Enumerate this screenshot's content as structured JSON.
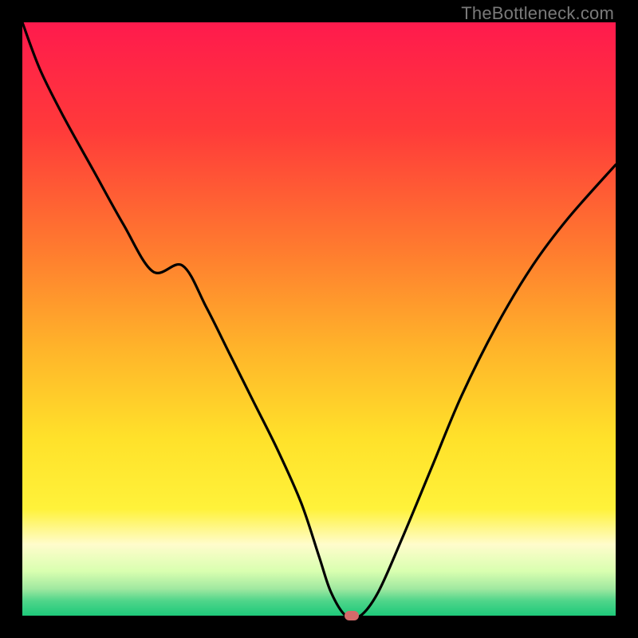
{
  "watermark": "TheBottleneck.com",
  "chart_data": {
    "type": "line",
    "title": "",
    "xlabel": "",
    "ylabel": "",
    "xlim": [
      0,
      100
    ],
    "ylim": [
      0,
      100
    ],
    "gradient_stops": [
      {
        "pos": 0.0,
        "color": "#ff1a4d"
      },
      {
        "pos": 0.18,
        "color": "#ff3a3a"
      },
      {
        "pos": 0.38,
        "color": "#ff7a2f"
      },
      {
        "pos": 0.55,
        "color": "#ffb42a"
      },
      {
        "pos": 0.7,
        "color": "#ffe12a"
      },
      {
        "pos": 0.82,
        "color": "#fff23a"
      },
      {
        "pos": 0.88,
        "color": "#fffccc"
      },
      {
        "pos": 0.925,
        "color": "#d9ffb0"
      },
      {
        "pos": 0.955,
        "color": "#9fe8a0"
      },
      {
        "pos": 0.975,
        "color": "#4fd58a"
      },
      {
        "pos": 1.0,
        "color": "#1ec97a"
      }
    ],
    "series": [
      {
        "name": "bottleneck-curve",
        "x": [
          0,
          3,
          7,
          12,
          17,
          22,
          27,
          31,
          35,
          39,
          43,
          47,
          50,
          52,
          54.5,
          57,
          60,
          64,
          69,
          74,
          80,
          86,
          92,
          100
        ],
        "y": [
          100,
          92,
          84,
          75,
          66,
          58,
          59,
          52,
          44,
          36,
          28,
          19,
          10,
          4,
          0,
          0,
          4,
          13,
          25,
          37,
          49,
          59,
          67,
          76
        ]
      }
    ],
    "marker": {
      "x": 55.5,
      "y": 0,
      "color": "#d46a6a"
    },
    "grid": false,
    "legend": false
  }
}
